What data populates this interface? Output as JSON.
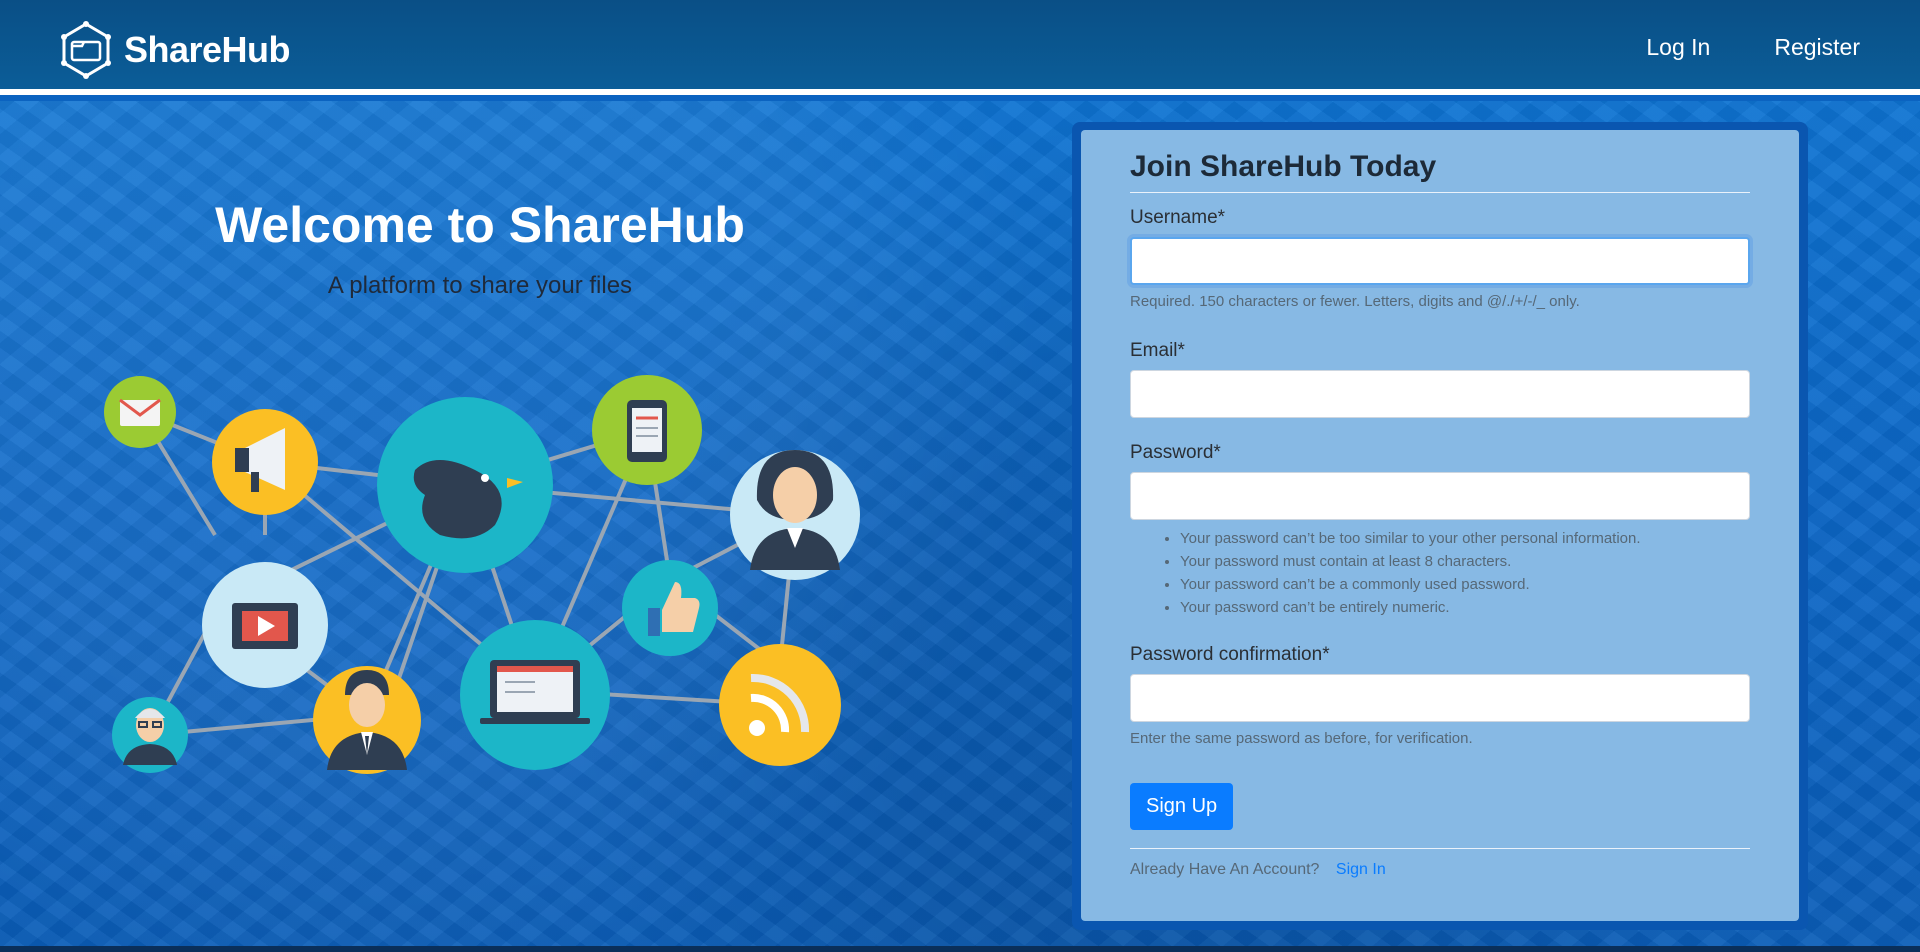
{
  "nav": {
    "brand": "ShareHub",
    "links": [
      {
        "label": "Log In"
      },
      {
        "label": "Register"
      }
    ]
  },
  "hero": {
    "title": "Welcome to ShareHub",
    "subtitle": "A platform to share your files"
  },
  "form": {
    "title": "Join ShareHub Today",
    "username": {
      "label": "Username*",
      "value": "",
      "help": "Required. 150 characters or fewer. Letters, digits and @/./+/-/_ only."
    },
    "email": {
      "label": "Email*",
      "value": ""
    },
    "password": {
      "label": "Password*",
      "value": "",
      "rules": [
        "Your password can’t be too similar to your other personal information.",
        "Your password must contain at least 8 characters.",
        "Your password can’t be a commonly used password.",
        "Your password can’t be entirely numeric."
      ]
    },
    "password_confirmation": {
      "label": "Password confirmation*",
      "value": "",
      "help": "Enter the same password as before, for verification."
    },
    "submit_label": "Sign Up",
    "account_prompt": "Already Have An Account?",
    "signin_label": "Sign In"
  },
  "colors": {
    "navbar": "#0a5790",
    "background": "#0b66c6",
    "card": "#87b9e4",
    "primary_button": "#0a7cff"
  },
  "illustration": {
    "nodes": [
      "mail-icon",
      "megaphone-icon",
      "bird-icon",
      "smartphone-icon",
      "businesswoman-avatar",
      "video-icon",
      "thumbs-up-icon",
      "elderly-man-avatar",
      "businessman-avatar",
      "laptop-icon",
      "rss-icon"
    ]
  }
}
